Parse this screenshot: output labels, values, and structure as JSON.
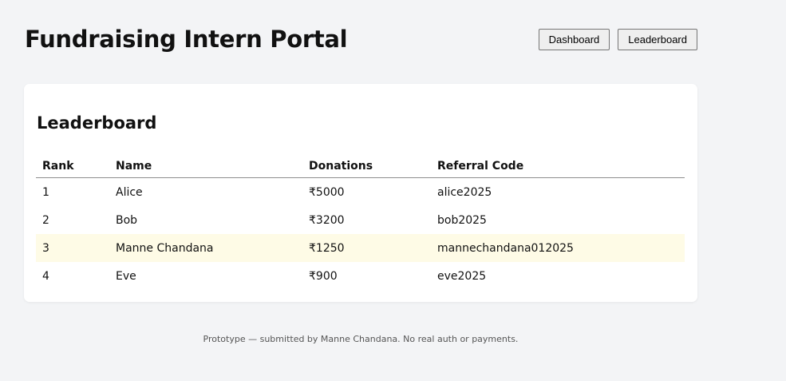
{
  "app": {
    "title": "Fundraising Intern Portal"
  },
  "nav": {
    "dashboard_label": "Dashboard",
    "leaderboard_label": "Leaderboard"
  },
  "leaderboard": {
    "title": "Leaderboard",
    "columns": [
      "Rank",
      "Name",
      "Donations",
      "Referral Code"
    ],
    "rows": [
      {
        "rank": "1",
        "name": "Alice",
        "donations": "₹5000",
        "referral_code": "alice2025"
      },
      {
        "rank": "2",
        "name": "Bob",
        "donations": "₹3200",
        "referral_code": "bob2025"
      },
      {
        "rank": "3",
        "name": "Manne Chandana",
        "donations": "₹1250",
        "referral_code": "mannechandana012025"
      },
      {
        "rank": "4",
        "name": "Eve",
        "donations": "₹900",
        "referral_code": "eve2025"
      }
    ],
    "highlighted_rank": "3",
    "highlight_color": "#fefbe6"
  },
  "footer": {
    "note": "Prototype — submitted by Manne Chandana. No real auth or payments."
  },
  "colors": {
    "page_background": "#f3f4f6",
    "card_background": "#ffffff"
  }
}
